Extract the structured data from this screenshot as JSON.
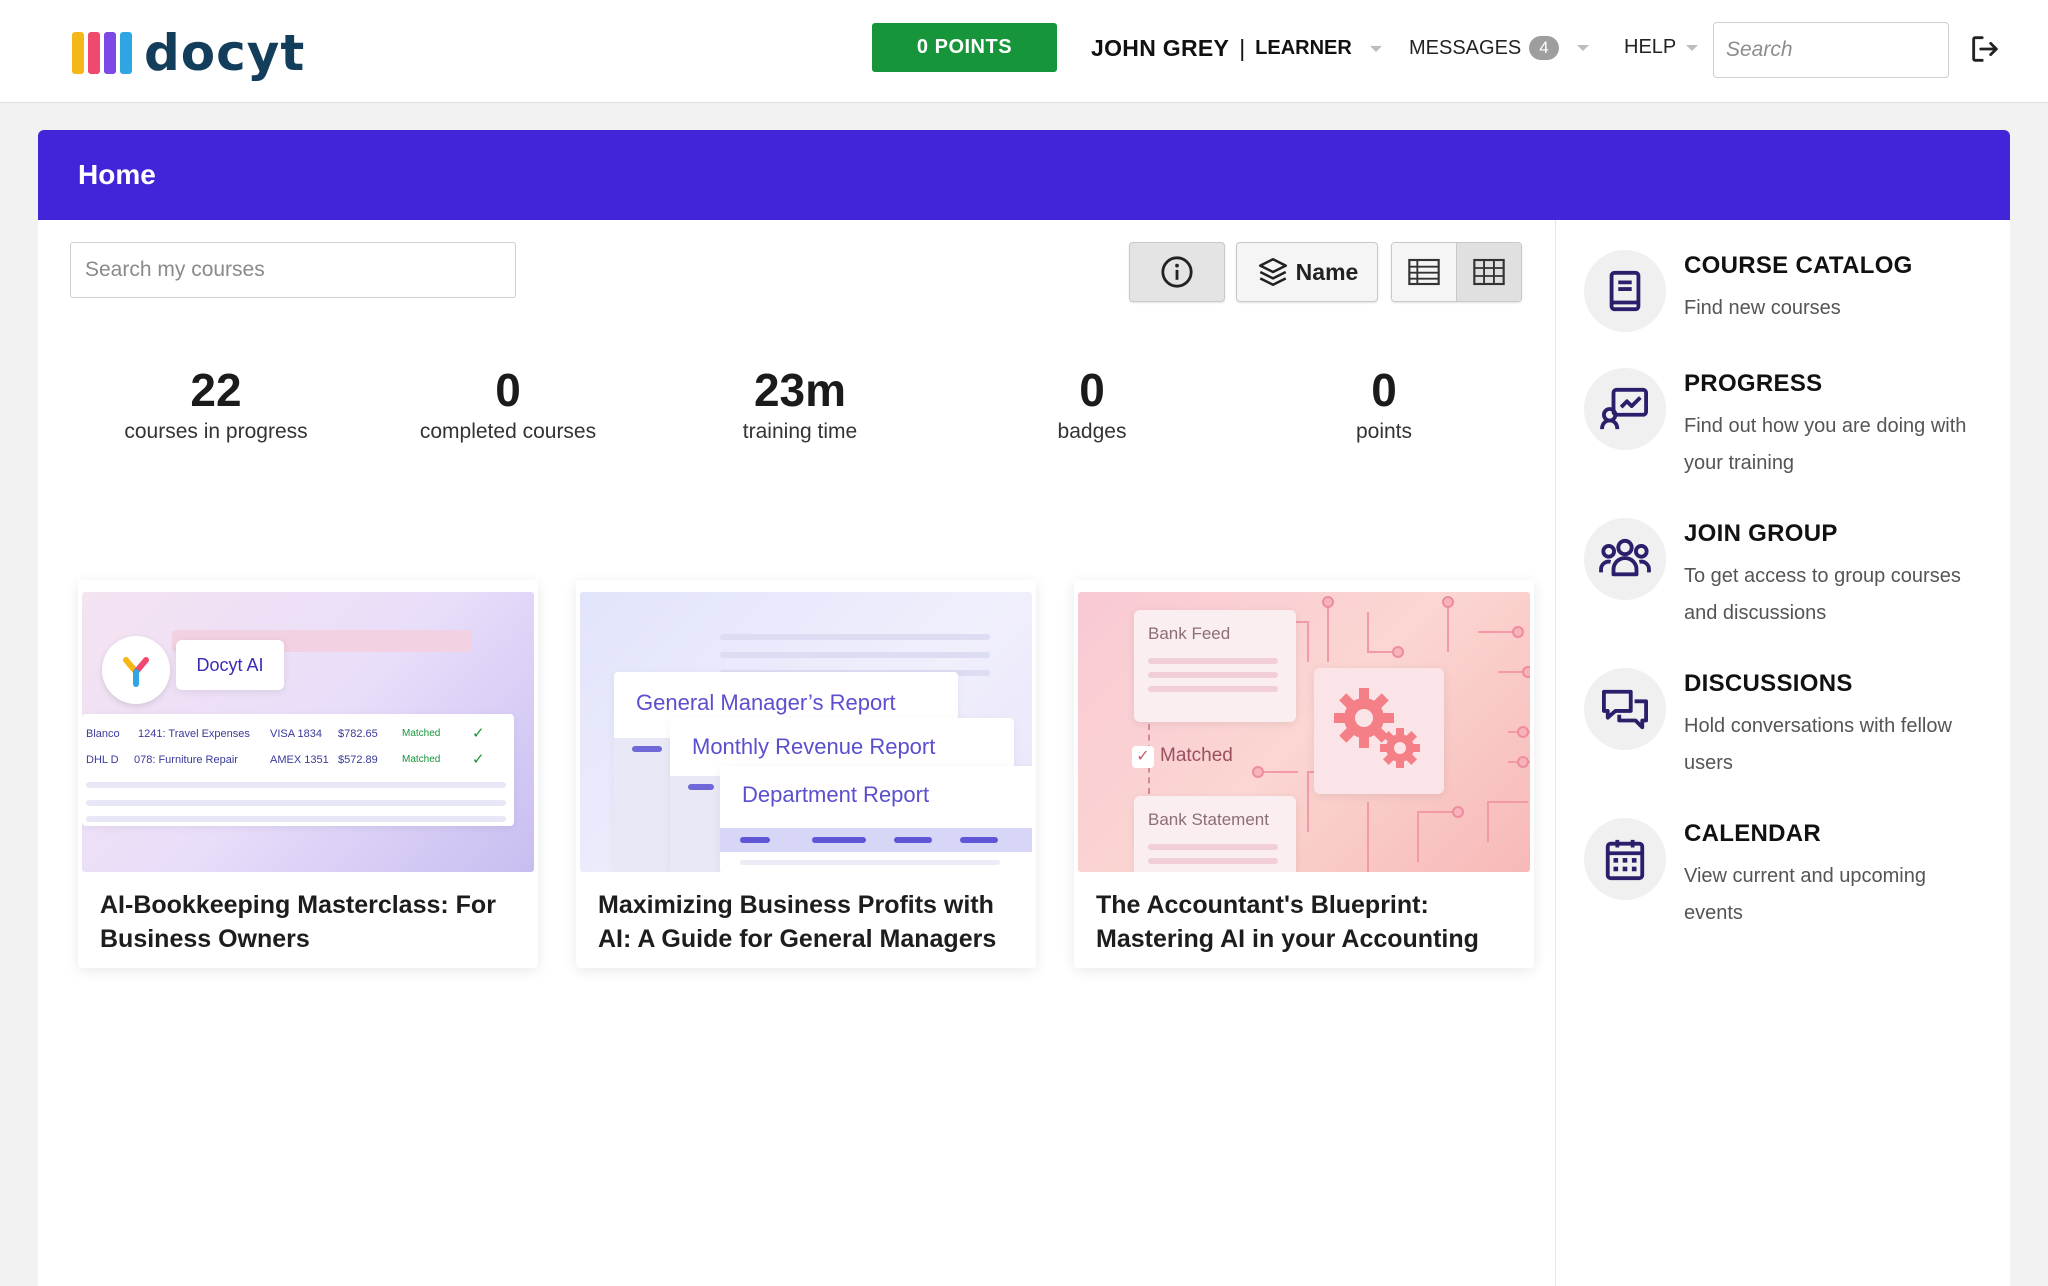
{
  "brand": {
    "name": "docyt",
    "bar_colors": [
      "#f5b715",
      "#ef4a6e",
      "#7c48e6",
      "#2fa5e4"
    ],
    "text_color": "#123e5c"
  },
  "header": {
    "points_label": "0 POINTS",
    "user_name": "JOHN GREY",
    "user_separator": "|",
    "user_role": "LEARNER",
    "messages_label": "MESSAGES",
    "messages_count": "4",
    "help_label": "HELP",
    "search_placeholder": "Search"
  },
  "page": {
    "title": "Home",
    "accent_color": "#4325d9",
    "course_search_placeholder": "Search my courses",
    "sort_label": "Name"
  },
  "stats": [
    {
      "value": "22",
      "label": "courses in progress"
    },
    {
      "value": "0",
      "label": "completed courses"
    },
    {
      "value": "23m",
      "label": "training time"
    },
    {
      "value": "0",
      "label": "badges"
    },
    {
      "value": "0",
      "label": "points"
    }
  ],
  "courses": [
    {
      "title": "AI-Bookkeeping Masterclass: For Business Owners",
      "thumb": {
        "pill": "Docyt AI",
        "rows": [
          [
            "Blanco",
            "1241: Travel Expenses",
            "VISA 1834",
            "$782.65",
            "Matched"
          ],
          [
            "DHL D",
            "078: Furniture Repair",
            "AMEX 1351",
            "$572.89",
            "Matched"
          ]
        ]
      }
    },
    {
      "title": "Maximizing Business Profits with AI: A Guide for General Managers",
      "thumb": {
        "reports": [
          "General Manager’s Report",
          "Monthly Revenue Report",
          "Department Report"
        ]
      }
    },
    {
      "title": "The Accountant's Blueprint: Mastering AI in your Accounting",
      "thumb": {
        "bank_feed": "Bank Feed",
        "matched": "Matched",
        "bank_statement": "Bank Statement"
      }
    }
  ],
  "sidebar": [
    {
      "icon": "book-icon",
      "title": "COURSE CATALOG",
      "desc": "Find new courses"
    },
    {
      "icon": "progress-chart-icon",
      "title": "PROGRESS",
      "desc": "Find out how you are doing with your training"
    },
    {
      "icon": "group-icon",
      "title": "JOIN GROUP",
      "desc": "To get access to group courses and discussions"
    },
    {
      "icon": "chat-bubbles-icon",
      "title": "DISCUSSIONS",
      "desc": "Hold conversations with fellow users"
    },
    {
      "icon": "calendar-icon",
      "title": "CALENDAR",
      "desc": "View current and upcoming events"
    }
  ],
  "icon_color": "#2a1f6b",
  "points_color": "#16953a"
}
